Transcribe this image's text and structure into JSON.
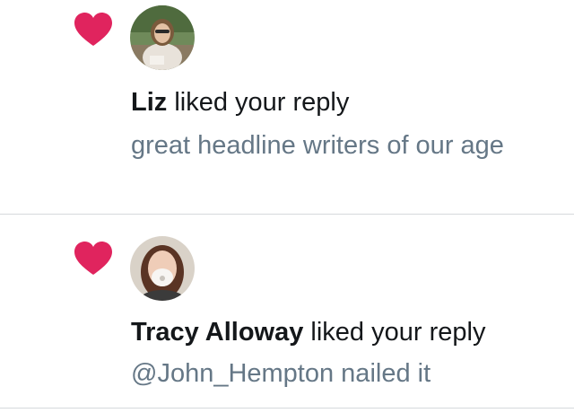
{
  "notifications": [
    {
      "type": "like",
      "icon": "heart-icon",
      "user": "Liz",
      "action": " liked your reply",
      "reply": "great headline writers of our age"
    },
    {
      "type": "like",
      "icon": "heart-icon",
      "user": "Tracy Alloway",
      "action": " liked your reply",
      "reply": "@John_Hempton nailed it"
    }
  ],
  "colors": {
    "heart": "#e0245e",
    "primary_text": "#14171a",
    "secondary_text": "#657786",
    "divider": "#d6d9dc"
  }
}
